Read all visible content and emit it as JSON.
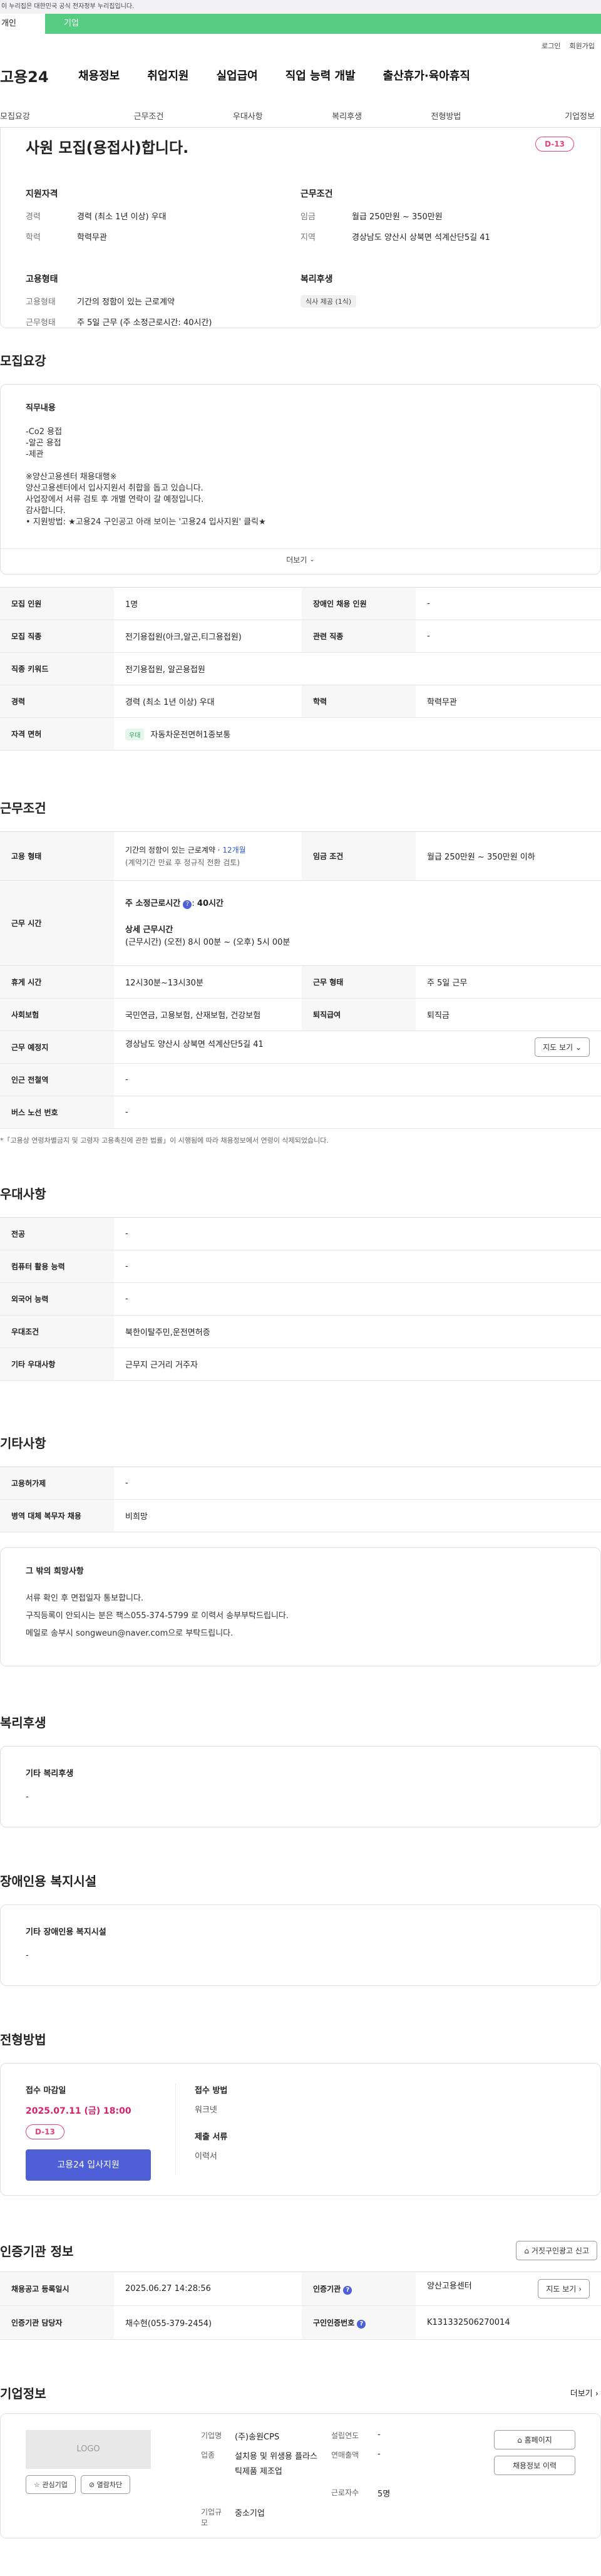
{
  "gov_banner": "이 누리집은 대한민국 공식 전자정부 누리집입니다.",
  "top_tabs": {
    "personal": "개인",
    "business": "기업"
  },
  "util": {
    "login": "로그인",
    "signup": "회원가입"
  },
  "logo": "고용24",
  "gnb": [
    "채용정보",
    "취업지원",
    "실업급여",
    "직업 능력 개발",
    "출산휴가·육아휴직"
  ],
  "subnav": [
    "모집요강",
    "근무조건",
    "우대사항",
    "복리후생",
    "전형방법",
    "기업정보"
  ],
  "hero": {
    "title": "사원 모집(용접사)합니다.",
    "dday": "D-13",
    "qual_h": "지원자격",
    "career_k": "경력",
    "career_v": "경력 (최소 1년 이상) 우대",
    "edu_k": "학력",
    "edu_v": "학력무관",
    "emp_h": "고용형태",
    "emp_type_k": "고용형태",
    "emp_type_v": "기간의 정함이 있는 근로계약",
    "work_type_k": "근무형태",
    "work_type_v": "주 5일 근무 (주 소정근로시간: 40시간)",
    "cond_h": "근무조건",
    "wage_k": "임금",
    "wage_v": "월급 250만원 ~ 350만원",
    "area_k": "지역",
    "area_v": "경상남도 양산시 상북면 석계산단5길 41",
    "welfare_h": "복리후생",
    "welfare_badge": "식사 제공 (1식)"
  },
  "recruit": {
    "title": "모집요강",
    "job_h": "직무내용",
    "job_text": "-Co2 용접\n-알곤 용접\n-제관\n\n※양산고용센터 채용대행※\n양산고용센터에서 입사지원서 취합을 돕고 있습니다.\n사업장에서 서류 검토 후 개별 연락이 갈 예정입니다.\n감사합니다.\n• 지원방법: ★고용24 구인공고 아래 보이는 '고용24 입사지원' 클릭★",
    "more": "더보기",
    "rows": [
      {
        "k1": "모집 인원",
        "v1": "1명",
        "k2": "장애인 채용 인원",
        "v2": "-"
      },
      {
        "k1": "모집 직종",
        "v1": "전기용접원(아크,알곤,티그용접원)",
        "k2": "관련 직종",
        "v2": "-"
      },
      {
        "k1": "직종 키워드",
        "v1": "전기용접원, 알곤용접원",
        "k2": "",
        "v2": ""
      },
      {
        "k1": "경력",
        "v1": "경력 (최소 1년 이상) 우대",
        "k2": "학력",
        "v2": "학력무관"
      },
      {
        "k1": "자격 면허",
        "tag": "우대",
        "v1": "자동차운전면허1종보통",
        "k2": "",
        "v2": ""
      }
    ]
  },
  "work": {
    "title": "근무조건",
    "emp_k": "고용 형태",
    "emp_v1": "기간의 정함이 있는 근로계약 · ",
    "emp_period": "12개월",
    "emp_v2": "(계약기간 만료 후 정규직 전환 검토)",
    "wage_k": "임금 조건",
    "wage_v": "월급 250만원 ~ 350만원 이하",
    "hours_k": "근무 시간",
    "hours_main": "주 소정근로시간",
    "hours_val": "40시간",
    "hours_detail_h": "상세 근무시간",
    "hours_detail": "(근무시간) (오전) 8시 00분 ~ (오후) 5시 00분",
    "break_k": "휴게 시간",
    "break_v": "12시30분~13시30분",
    "form_k": "근무 형태",
    "form_v": "주 5일 근무",
    "ins_k": "사회보험",
    "ins_v": "국민연금, 고용보험, 산재보험, 건강보험",
    "sev_k": "퇴직급여",
    "sev_v": "퇴직금",
    "place_k": "근무 예정지",
    "place_v": "경상남도 양산시 상북면 석계산단5길 41",
    "map_btn": "지도 보기",
    "subway_k": "인근 전철역",
    "subway_v": "-",
    "bus_k": "버스 노선 번호",
    "bus_v": "-",
    "note": "*「고용상 연령차별금지 및 고령자 고용촉진에 관한 법률」이 시행됨에 따라 채용정보에서 연령이 삭제되었습니다."
  },
  "pref": {
    "title": "우대사항",
    "rows": [
      {
        "k": "전공",
        "v": "-"
      },
      {
        "k": "컴퓨터 활용 능력",
        "v": "-"
      },
      {
        "k": "외국어 능력",
        "v": "-"
      },
      {
        "k": "우대조건",
        "v": "북한이탈주민,운전면허증"
      },
      {
        "k": "기타 우대사항",
        "v": "근무지 근거리 거주자"
      }
    ]
  },
  "etc": {
    "title": "기타사항",
    "rows": [
      {
        "k": "고용허가제",
        "v": "-"
      },
      {
        "k": "병역 대체 복무자 채용",
        "v": "비희망"
      }
    ],
    "box_h": "그 밖의 희망사항",
    "box_text": "서류 확인 후 면접일자 통보합니다.\n구직등록이 안되시는 분은 팩스055-374-5799 로 이력서 송부부탁드립니다.\n메일로 송부시 songweun@naver.com으로 부탁드립니다."
  },
  "welfare": {
    "title": "복리후생",
    "h": "기타 복리후생",
    "v": "-"
  },
  "disability": {
    "title": "장애인용 복지시설",
    "h": "기타 장애인용 복지시설",
    "v": "-"
  },
  "process": {
    "title": "전형방법",
    "deadline_h": "접수 마감일",
    "deadline_v": "2025.07.11 (금) 18:00",
    "dday": "D-13",
    "apply_btn": "고용24 입사지원",
    "method_h": "접수 방법",
    "method_v": "워크넷",
    "docs_h": "제출 서류",
    "docs_v": "이력서"
  },
  "cert": {
    "title": "인증기관 정보",
    "report_btn": "거짓구인광고 신고",
    "reg_k": "채용공고 등록일시",
    "reg_v": "2025.06.27 14:28:56",
    "agency_k": "인증기관",
    "agency_v": "양산고용센터",
    "map_btn": "지도 보기",
    "manager_k": "인증기관 담당자",
    "manager_v": "채수현(055-379-2454)",
    "auth_k": "구인인증번호",
    "auth_v": "K131332506270014"
  },
  "company": {
    "title": "기업정보",
    "more": "더보기",
    "logo": "LOGO",
    "fav_btn": "관심기업",
    "block_btn": "열람차단",
    "name_k": "기업명",
    "name_v": "(주)송원CPS",
    "founded_k": "설립연도",
    "founded_v": "-",
    "industry_k": "업종",
    "industry_v": "설치용 및 위생용 플라스틱제품 제조업",
    "sales_k": "연매출액",
    "sales_v": "-",
    "emp_k": "근로자수",
    "emp_v": "5명",
    "size_k": "기업규모",
    "size_v": "중소기업",
    "home_btn": "홈페이지",
    "jobs_btn": "채용정보 이력"
  }
}
